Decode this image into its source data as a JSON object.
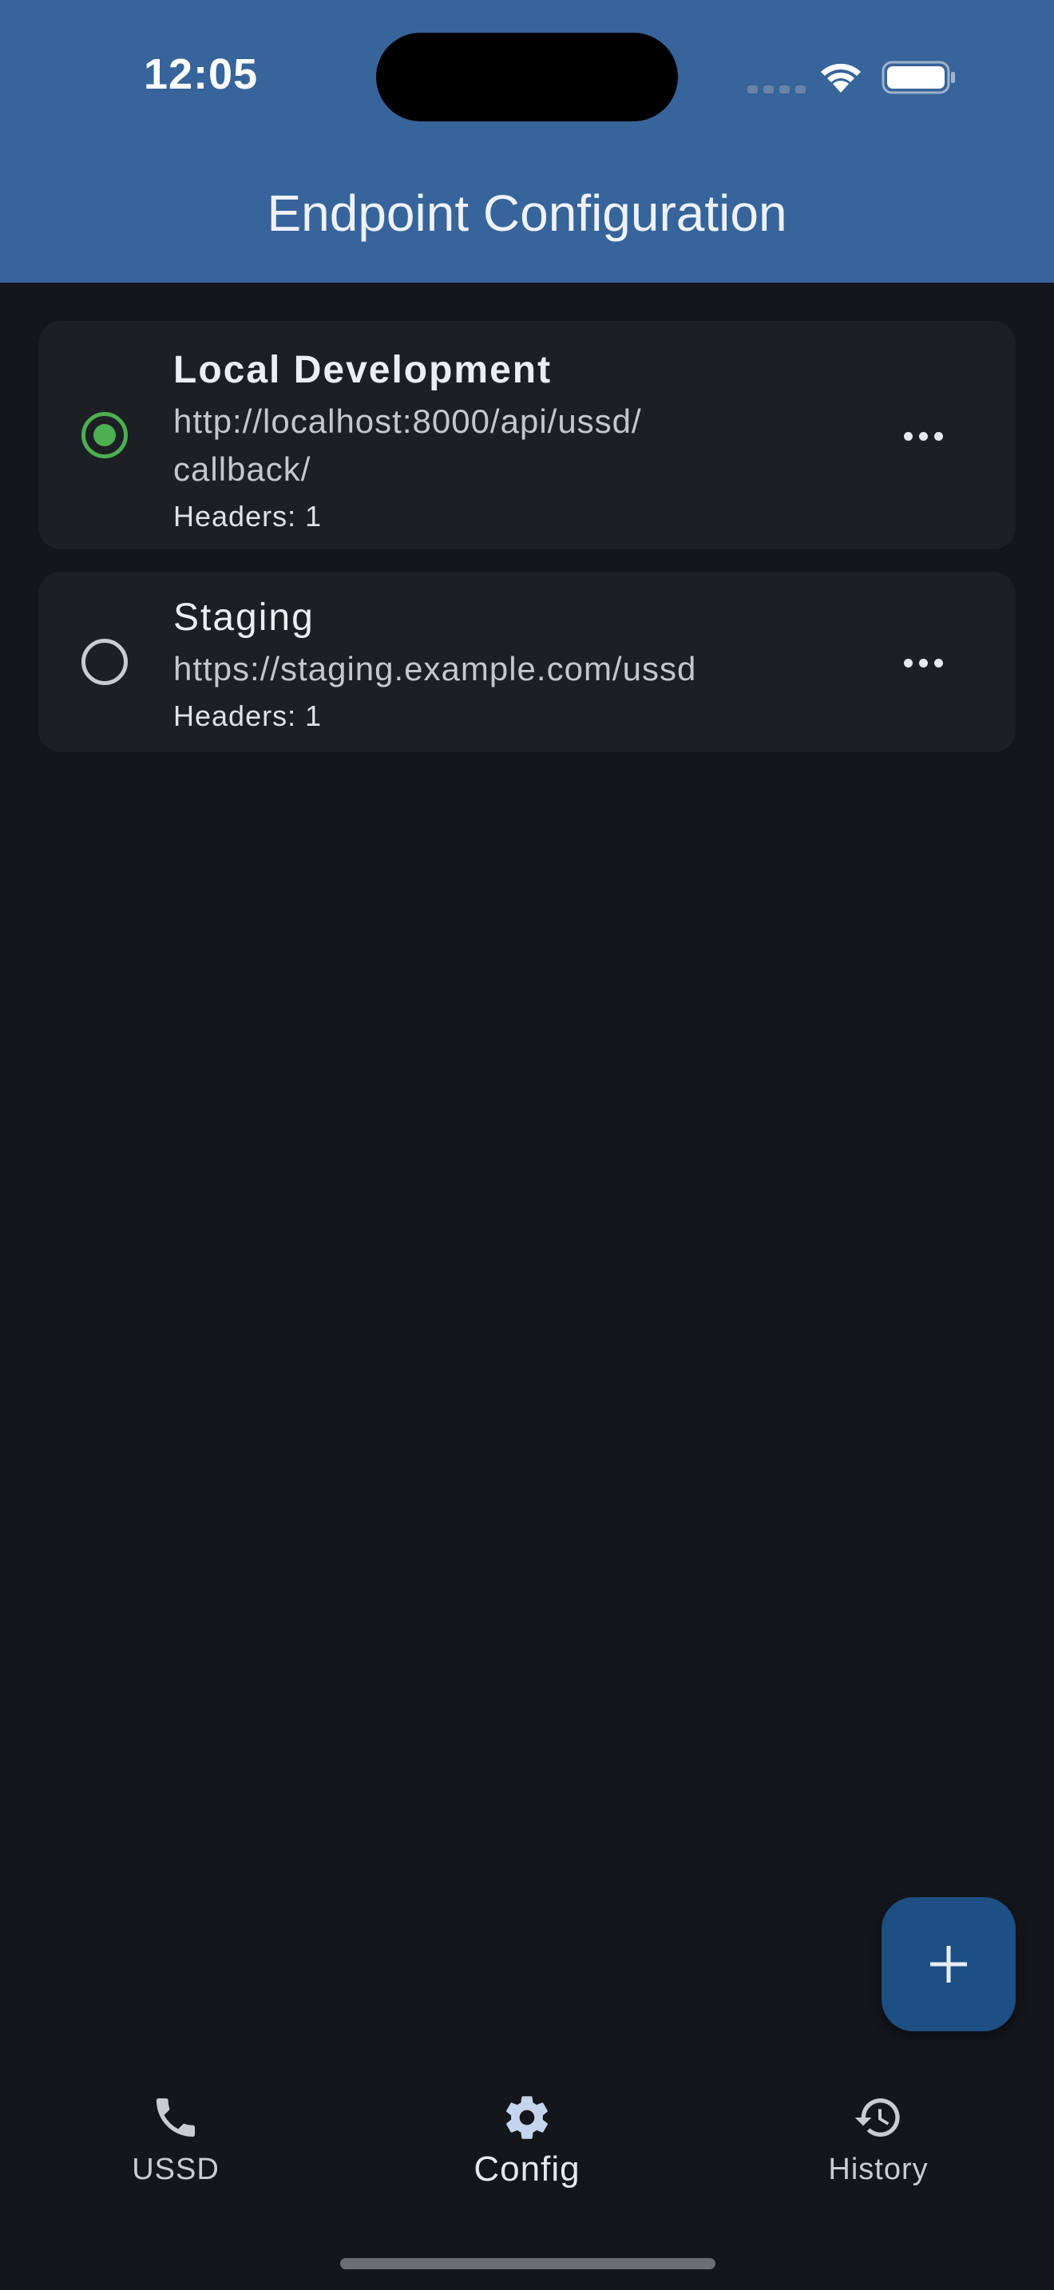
{
  "status_bar": {
    "time": "12:05"
  },
  "header": {
    "title": "Endpoint Configuration"
  },
  "endpoints": [
    {
      "name": "Local Development",
      "url_line1": "http://localhost:8000/api/ussd/",
      "url_line2": "callback/",
      "headers": "Headers: 1",
      "selected": true
    },
    {
      "name": "Staging",
      "url_line1": "https://staging.example.com/ussd",
      "headers": "Headers: 1",
      "selected": false
    }
  ],
  "fab": {
    "icon": "plus-icon"
  },
  "bottom_nav": {
    "items": [
      {
        "label": "USSD",
        "icon": "phone-icon",
        "active": false
      },
      {
        "label": "Config",
        "icon": "gear-icon",
        "active": true
      },
      {
        "label": "History",
        "icon": "history-icon",
        "active": false
      }
    ]
  },
  "colors": {
    "app_bar": "#37649a",
    "background": "#13161b",
    "card": "#1c1f24",
    "selected_radio": "#4caf50",
    "fab": "#1d4e84"
  }
}
